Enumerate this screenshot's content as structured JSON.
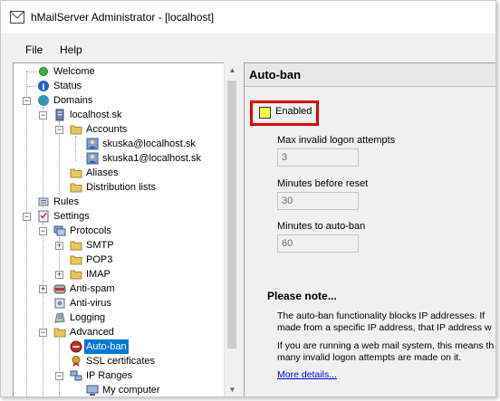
{
  "window": {
    "title": "hMailServer Administrator - [localhost]"
  },
  "menu": {
    "items": [
      "File",
      "Help"
    ]
  },
  "tree": {
    "welcome": "Welcome",
    "status": "Status",
    "domains": "Domains",
    "domain_localhost": "localhost.sk",
    "accounts": "Accounts",
    "account1": "skuska@localhost.sk",
    "account2": "skuska1@localhost.sk",
    "aliases": "Aliases",
    "distribution_lists": "Distribution lists",
    "rules": "Rules",
    "settings": "Settings",
    "protocols": "Protocols",
    "smtp": "SMTP",
    "pop3": "POP3",
    "imap": "IMAP",
    "anti_spam": "Anti-spam",
    "anti_virus": "Anti-virus",
    "logging": "Logging",
    "advanced": "Advanced",
    "auto_ban": "Auto-ban",
    "ssl_certificates": "SSL certificates",
    "ip_ranges": "IP Ranges",
    "my_computer": "My computer"
  },
  "panel": {
    "title": "Auto-ban",
    "enabled_label": "Enabled",
    "enabled_checked": false,
    "max_invalid_label": "Max invalid logon attempts",
    "max_invalid_value": "3",
    "minutes_reset_label": "Minutes before reset",
    "minutes_reset_value": "30",
    "minutes_autoban_label": "Minutes to auto-ban",
    "minutes_autoban_value": "60",
    "note_title": "Please note...",
    "note_line1": "The auto-ban functionality blocks IP addresses. If",
    "note_line2": "made from a specific IP address, that IP address w",
    "note_line3": "If you are running a web mail system, this means th",
    "note_line4": "many invalid logon attempts are made on it.",
    "more_details": "More details..."
  },
  "colors": {
    "selection": "#0078d7",
    "highlight_box": "#e00000",
    "checkbox_fill": "#ffff4d",
    "link": "#0000ee"
  }
}
